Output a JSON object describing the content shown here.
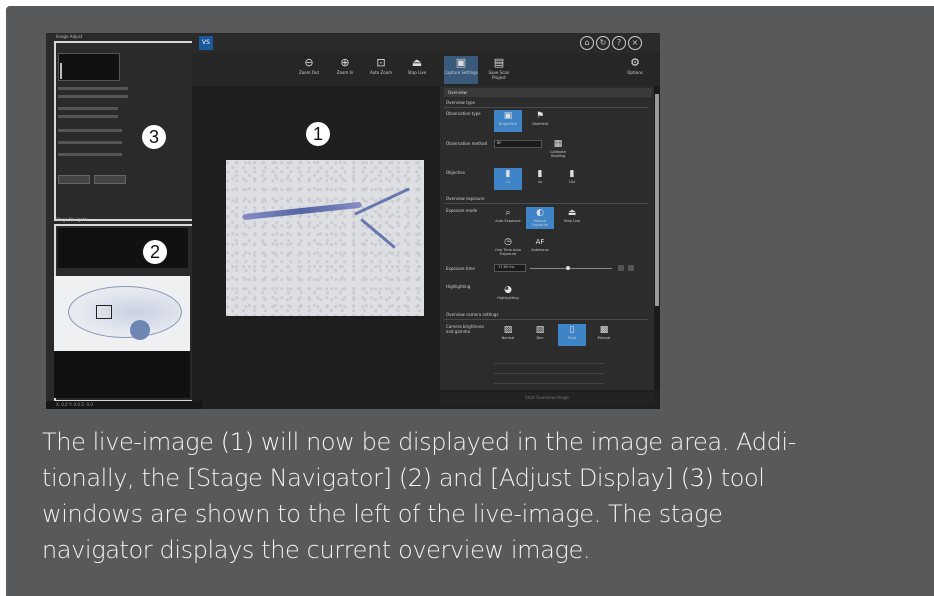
{
  "screenshot": {
    "app_logo": "VS",
    "adjust_display_title": "Image Adjust",
    "stage_navigator_title": "Stage Navigator",
    "status_bar_text": "X: 0.0 Y: 0.0 Z: 0.0",
    "toolbar": [
      {
        "icon": "zoom-out-icon",
        "glyph": "⊖",
        "label": "Zoom Out"
      },
      {
        "icon": "zoom-in-icon",
        "glyph": "⊕",
        "label": "Zoom In"
      },
      {
        "icon": "auto-zoom-icon",
        "glyph": "⊡",
        "label": "Auto Zoom"
      },
      {
        "icon": "stop-live-icon",
        "glyph": "⏏",
        "label": "Stop Live"
      },
      {
        "icon": "capture-settings-icon",
        "glyph": "▣",
        "label": "Capture Settings"
      },
      {
        "icon": "save-scan-project-icon",
        "glyph": "▤",
        "label": "Save Scan Project"
      },
      {
        "icon": "options-gear-icon",
        "glyph": "⚙",
        "label": "Options"
      }
    ],
    "settings": {
      "header": "Overview",
      "sections": {
        "overview_type": "Overview type",
        "observation_type": "Observation type",
        "observation_method": "Observation method",
        "objective": "Objective",
        "overview_exposure": "Overview exposure",
        "exposure_mode": "Exposure mode",
        "exposure_time": "Exposure time",
        "highlighting": "Highlighting",
        "camera_settings": "Overview camera settings",
        "camera_brightness": "Camera brightness and gamma"
      },
      "observation_options": [
        "Brightfield",
        "Darkfield"
      ],
      "observation_method_value": "BF",
      "calibrate_label": "Calibrate Shading",
      "objectives": [
        "1x",
        "4x",
        "10x"
      ],
      "exposure_options": [
        "Auto Exposure",
        "Manual Exposure",
        "Stop Live",
        "One Time Auto Exposure",
        "Autofocus"
      ],
      "exposure_time_value": "17.65 ms",
      "highlighting_label": "Highlighting",
      "camera_options": [
        "Normal",
        "Dim",
        "Faint",
        "Manual"
      ],
      "bottom_button": "Start Overview Image"
    },
    "markers": [
      "1",
      "2",
      "3"
    ]
  },
  "caption": {
    "part1": "The live-image ",
    "ref1": "(1)",
    "part2": " will now be displayed in the image area. Addi-",
    "part3": "tionally, the [Stage Navigator] ",
    "ref2": "(2)",
    "part4": " and [Adjust Display] ",
    "ref3": "(3)",
    "part5": " tool",
    "part6": "windows are shown to the left of the live-image. The stage",
    "part7": "navigator displays the current overview image."
  },
  "colors": {
    "card_bg": "#57595b",
    "accent_blue": "#3f84c6",
    "text_light": "#f2f2f2"
  }
}
